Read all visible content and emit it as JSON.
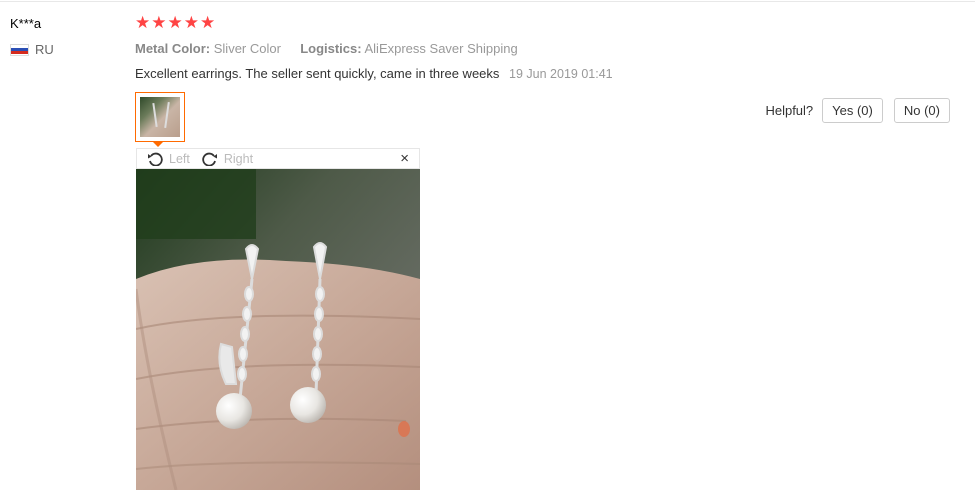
{
  "review": {
    "user_name": "K***a",
    "country": "RU",
    "stars": [
      "★",
      "★",
      "★",
      "★",
      "★"
    ],
    "attributes": [
      {
        "key": "Metal Color:",
        "value": "Sliver Color"
      },
      {
        "key": "Logistics:",
        "value": "AliExpress Saver Shipping"
      }
    ],
    "text": "Excellent earrings. The seller sent quickly, came in three weeks",
    "date": "19 Jun 2019 01:41"
  },
  "helpful": {
    "label": "Helpful?",
    "yes": "Yes (0)",
    "no": "No (0)"
  },
  "viewer": {
    "rotate_left": "Left",
    "rotate_right": "Right",
    "close": "×"
  },
  "colors": {
    "star": "#ff4747",
    "accent": "#ff6a00",
    "muted": "#999999"
  },
  "icons": {
    "rotate_left": "rotate-left-icon",
    "rotate_right": "rotate-right-icon",
    "close": "close-icon",
    "flag": "russia-flag-icon"
  }
}
